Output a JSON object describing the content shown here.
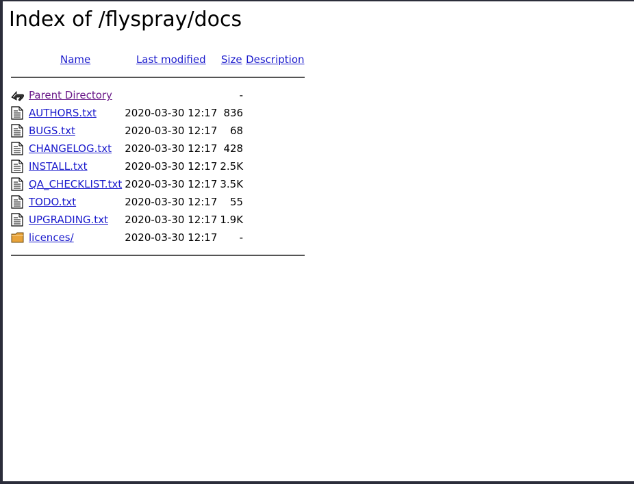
{
  "page": {
    "title": "Index of /flyspray/docs"
  },
  "columns": {
    "name": "Name",
    "last_modified": "Last modified",
    "size": "Size",
    "description": "Description"
  },
  "parent": {
    "label": "Parent Directory",
    "size": "-",
    "icon": "back-arrow-icon"
  },
  "entries": [
    {
      "name": "AUTHORS.txt",
      "date": "2020-03-30 12:17",
      "size": "836",
      "icon": "text-file-icon"
    },
    {
      "name": "BUGS.txt",
      "date": "2020-03-30 12:17",
      "size": "68",
      "icon": "text-file-icon"
    },
    {
      "name": "CHANGELOG.txt",
      "date": "2020-03-30 12:17",
      "size": "428",
      "icon": "text-file-icon"
    },
    {
      "name": "INSTALL.txt",
      "date": "2020-03-30 12:17",
      "size": "2.5K",
      "icon": "text-file-icon"
    },
    {
      "name": "QA_CHECKLIST.txt",
      "date": "2020-03-30 12:17",
      "size": "3.5K",
      "icon": "text-file-icon"
    },
    {
      "name": "TODO.txt",
      "date": "2020-03-30 12:17",
      "size": "55",
      "icon": "text-file-icon"
    },
    {
      "name": "UPGRADING.txt",
      "date": "2020-03-30 12:17",
      "size": "1.9K",
      "icon": "text-file-icon"
    },
    {
      "name": "licences/",
      "date": "2020-03-30 12:17",
      "size": "-",
      "icon": "folder-icon"
    }
  ]
}
